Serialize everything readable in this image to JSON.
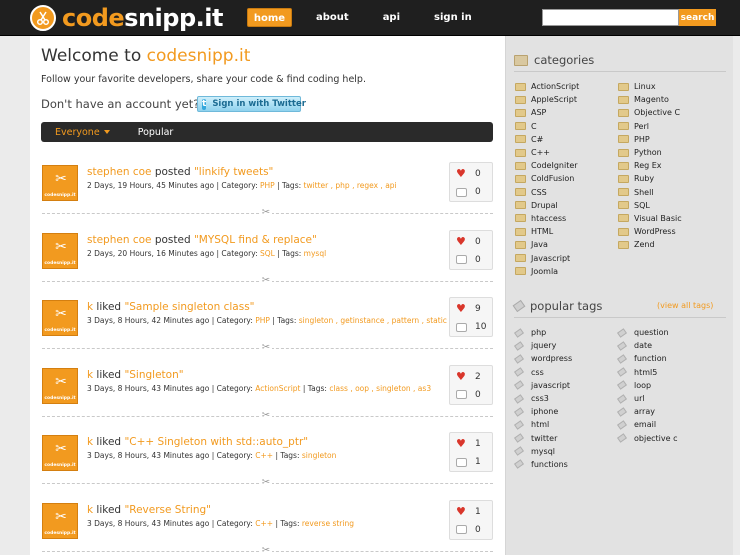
{
  "header": {
    "logo": {
      "part1": "code",
      "part2": "snipp.it"
    },
    "nav": {
      "home": "home",
      "about": "about",
      "api": "api",
      "signin": "sign in"
    },
    "search": {
      "value": "",
      "placeholder": "",
      "button": "search"
    }
  },
  "main": {
    "welcome_prefix": "Welcome to ",
    "welcome_brand": "codesnipp.it",
    "tagline": "Follow your favorite developers, share your code & find coding help.",
    "no_account": "Don't have an account yet?",
    "twitter_button": "Sign in with Twitter",
    "filters": {
      "everyone": "Everyone",
      "popular": "Popular"
    }
  },
  "posts": [
    {
      "user": "stephen coe",
      "action": " posted ",
      "snippet": "\"linkify tweets\"",
      "meta_prefix": "2 Days, 19 Hours, 45 Minutes ago | Category: ",
      "category": "PHP",
      "tags_prefix": " | Tags: ",
      "tags_text": "twitter , php , regex , api",
      "likes": "0",
      "comments": "0"
    },
    {
      "user": "stephen coe",
      "action": " posted ",
      "snippet": "\"MYSQL find & replace\"",
      "meta_prefix": "2 Days, 20 Hours, 16 Minutes ago | Category: ",
      "category": "SQL",
      "tags_prefix": " | Tags: ",
      "tags_text": "mysql",
      "likes": "0",
      "comments": "0"
    },
    {
      "user": "k",
      "action": " liked ",
      "snippet": "\"Sample singleton class\"",
      "meta_prefix": "3 Days, 8 Hours, 42 Minutes ago | Category: ",
      "category": "PHP",
      "tags_prefix": " | Tags: ",
      "tags_text": "singleton , getinstance , pattern , static",
      "likes": "9",
      "comments": "10"
    },
    {
      "user": "k",
      "action": " liked ",
      "snippet": "\"Singleton\"",
      "meta_prefix": "3 Days, 8 Hours, 43 Minutes ago | Category: ",
      "category": "ActionScript",
      "tags_prefix": " | Tags: ",
      "tags_text": "class , oop , singleton , as3",
      "likes": "2",
      "comments": "0"
    },
    {
      "user": "k",
      "action": " liked ",
      "snippet": "\"C++ Singleton with std::auto_ptr\"",
      "meta_prefix": "3 Days, 8 Hours, 43 Minutes ago | Category: ",
      "category": "C++",
      "tags_prefix": " | Tags: ",
      "tags_text": "singleton",
      "likes": "1",
      "comments": "1"
    },
    {
      "user": "k",
      "action": " liked ",
      "snippet": "\"Reverse String\"",
      "meta_prefix": "3 Days, 8 Hours, 43 Minutes ago | Category: ",
      "category": "C++",
      "tags_prefix": " | Tags: ",
      "tags_text": "reverse string",
      "likes": "1",
      "comments": "0"
    }
  ],
  "sidebar": {
    "categories_title": "categories",
    "categories_col1": [
      "ActionScript",
      "AppleScript",
      "ASP",
      "C",
      "C#",
      "C++",
      "CodeIgniter",
      "ColdFusion",
      "CSS",
      "Drupal",
      "htaccess",
      "HTML",
      "Java",
      "Javascript",
      "Joomla"
    ],
    "categories_col2": [
      "Linux",
      "Magento",
      "Objective C",
      "Perl",
      "PHP",
      "Python",
      "Reg Ex",
      "Ruby",
      "Shell",
      "SQL",
      "Visual Basic",
      "WordPress",
      "Zend"
    ],
    "tags_title": "popular tags",
    "view_all": "(view all tags)",
    "tags_col1": [
      "php",
      "jquery",
      "wordpress",
      "css",
      "javascript",
      "css3",
      "iphone",
      "html",
      "twitter",
      "mysql",
      "functions"
    ],
    "tags_col2": [
      "question",
      "date",
      "function",
      "html5",
      "loop",
      "url",
      "array",
      "email",
      "objective c"
    ]
  },
  "colors": {
    "accent": "#f29a1f",
    "topbar": "#1f1f1f",
    "heart": "#d9362b"
  }
}
